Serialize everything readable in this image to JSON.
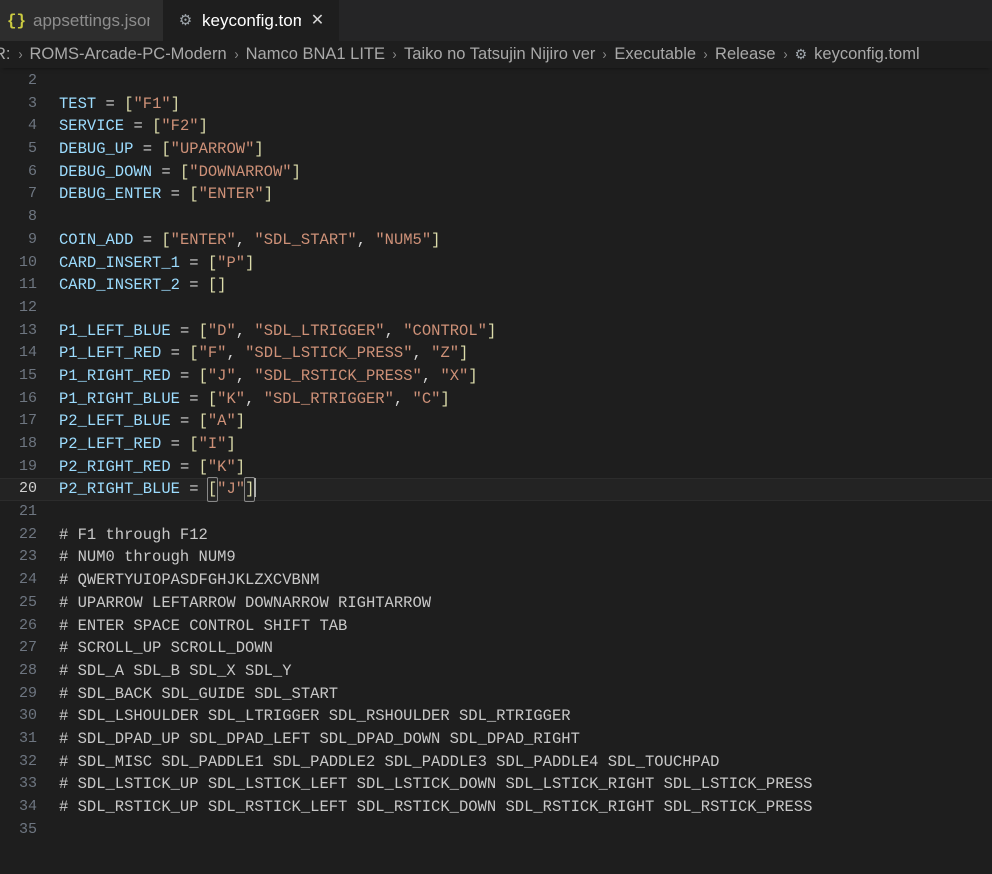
{
  "window": {
    "background": "#1e1e1e",
    "theme_name": "dark"
  },
  "tabbar": {
    "tabs": [
      {
        "label": "appsettings.json",
        "icon": "json-braces-icon",
        "icon_glyph": "{}",
        "icon_color": "#cbcb41",
        "active": false,
        "closable": false
      },
      {
        "label": "keyconfig.toml",
        "icon": "gear-icon",
        "icon_glyph": "⚙",
        "icon_color": "#a0a7ad",
        "active": true,
        "closable": true,
        "close_glyph": "✕"
      }
    ]
  },
  "breadcrumbs": {
    "separator": "›",
    "items": [
      {
        "label": "R:",
        "icon": null
      },
      {
        "label": "ROMS-Arcade-PC-Modern",
        "icon": null
      },
      {
        "label": "Namco BNA1 LITE",
        "icon": null
      },
      {
        "label": "Taiko no Tatsujin Nijiro ver",
        "icon": null
      },
      {
        "label": "Executable",
        "icon": null
      },
      {
        "label": "Release",
        "icon": null
      },
      {
        "label": "keyconfig.toml",
        "icon": "gear-icon",
        "icon_glyph": "⚙"
      }
    ]
  },
  "editor": {
    "language": "toml",
    "file_name": "keyconfig.toml",
    "cursor_line": 20,
    "first_visible_line": 2,
    "last_visible_line": 35,
    "colors": {
      "key": "#9cdcfe",
      "string": "#ce9178",
      "bracket": "#dcdcaa",
      "operator": "#d4d4d4",
      "comment": "#c8c8c8",
      "line_number": "#6e7681",
      "line_number_active": "#d0d0d0",
      "current_line_bg": "#232323",
      "cursor": "#aeafad"
    },
    "lines": [
      {
        "n": 2,
        "tokens": []
      },
      {
        "n": 3,
        "tokens": [
          {
            "t": "key",
            "v": "TEST"
          },
          {
            "t": "plain",
            "v": " "
          },
          {
            "t": "eq",
            "v": "="
          },
          {
            "t": "plain",
            "v": " "
          },
          {
            "t": "brk",
            "v": "["
          },
          {
            "t": "str",
            "v": "\"F1\""
          },
          {
            "t": "brk",
            "v": "]"
          }
        ]
      },
      {
        "n": 4,
        "tokens": [
          {
            "t": "key",
            "v": "SERVICE"
          },
          {
            "t": "plain",
            "v": " "
          },
          {
            "t": "eq",
            "v": "="
          },
          {
            "t": "plain",
            "v": " "
          },
          {
            "t": "brk",
            "v": "["
          },
          {
            "t": "str",
            "v": "\"F2\""
          },
          {
            "t": "brk",
            "v": "]"
          }
        ]
      },
      {
        "n": 5,
        "tokens": [
          {
            "t": "key",
            "v": "DEBUG_UP"
          },
          {
            "t": "plain",
            "v": " "
          },
          {
            "t": "eq",
            "v": "="
          },
          {
            "t": "plain",
            "v": " "
          },
          {
            "t": "brk",
            "v": "["
          },
          {
            "t": "str",
            "v": "\"UPARROW\""
          },
          {
            "t": "brk",
            "v": "]"
          }
        ]
      },
      {
        "n": 6,
        "tokens": [
          {
            "t": "key",
            "v": "DEBUG_DOWN"
          },
          {
            "t": "plain",
            "v": " "
          },
          {
            "t": "eq",
            "v": "="
          },
          {
            "t": "plain",
            "v": " "
          },
          {
            "t": "brk",
            "v": "["
          },
          {
            "t": "str",
            "v": "\"DOWNARROW\""
          },
          {
            "t": "brk",
            "v": "]"
          }
        ]
      },
      {
        "n": 7,
        "tokens": [
          {
            "t": "key",
            "v": "DEBUG_ENTER"
          },
          {
            "t": "plain",
            "v": " "
          },
          {
            "t": "eq",
            "v": "="
          },
          {
            "t": "plain",
            "v": " "
          },
          {
            "t": "brk",
            "v": "["
          },
          {
            "t": "str",
            "v": "\"ENTER\""
          },
          {
            "t": "brk",
            "v": "]"
          }
        ]
      },
      {
        "n": 8,
        "tokens": []
      },
      {
        "n": 9,
        "tokens": [
          {
            "t": "key",
            "v": "COIN_ADD"
          },
          {
            "t": "plain",
            "v": " "
          },
          {
            "t": "eq",
            "v": "="
          },
          {
            "t": "plain",
            "v": " "
          },
          {
            "t": "brk",
            "v": "["
          },
          {
            "t": "str",
            "v": "\"ENTER\""
          },
          {
            "t": "punct",
            "v": ", "
          },
          {
            "t": "str",
            "v": "\"SDL_START\""
          },
          {
            "t": "punct",
            "v": ", "
          },
          {
            "t": "str",
            "v": "\"NUM5\""
          },
          {
            "t": "brk",
            "v": "]"
          }
        ]
      },
      {
        "n": 10,
        "tokens": [
          {
            "t": "key",
            "v": "CARD_INSERT_1"
          },
          {
            "t": "plain",
            "v": " "
          },
          {
            "t": "eq",
            "v": "="
          },
          {
            "t": "plain",
            "v": " "
          },
          {
            "t": "brk",
            "v": "["
          },
          {
            "t": "str",
            "v": "\"P\""
          },
          {
            "t": "brk",
            "v": "]"
          }
        ]
      },
      {
        "n": 11,
        "tokens": [
          {
            "t": "key",
            "v": "CARD_INSERT_2"
          },
          {
            "t": "plain",
            "v": " "
          },
          {
            "t": "eq",
            "v": "="
          },
          {
            "t": "plain",
            "v": " "
          },
          {
            "t": "brk",
            "v": "[]"
          }
        ]
      },
      {
        "n": 12,
        "tokens": []
      },
      {
        "n": 13,
        "tokens": [
          {
            "t": "key",
            "v": "P1_LEFT_BLUE"
          },
          {
            "t": "plain",
            "v": " "
          },
          {
            "t": "eq",
            "v": "="
          },
          {
            "t": "plain",
            "v": " "
          },
          {
            "t": "brk",
            "v": "["
          },
          {
            "t": "str",
            "v": "\"D\""
          },
          {
            "t": "punct",
            "v": ", "
          },
          {
            "t": "str",
            "v": "\"SDL_LTRIGGER\""
          },
          {
            "t": "punct",
            "v": ", "
          },
          {
            "t": "str",
            "v": "\"CONTROL\""
          },
          {
            "t": "brk",
            "v": "]"
          }
        ]
      },
      {
        "n": 14,
        "tokens": [
          {
            "t": "key",
            "v": "P1_LEFT_RED"
          },
          {
            "t": "plain",
            "v": " "
          },
          {
            "t": "eq",
            "v": "="
          },
          {
            "t": "plain",
            "v": " "
          },
          {
            "t": "brk",
            "v": "["
          },
          {
            "t": "str",
            "v": "\"F\""
          },
          {
            "t": "punct",
            "v": ", "
          },
          {
            "t": "str",
            "v": "\"SDL_LSTICK_PRESS\""
          },
          {
            "t": "punct",
            "v": ", "
          },
          {
            "t": "str",
            "v": "\"Z\""
          },
          {
            "t": "brk",
            "v": "]"
          }
        ]
      },
      {
        "n": 15,
        "tokens": [
          {
            "t": "key",
            "v": "P1_RIGHT_RED"
          },
          {
            "t": "plain",
            "v": " "
          },
          {
            "t": "eq",
            "v": "="
          },
          {
            "t": "plain",
            "v": " "
          },
          {
            "t": "brk",
            "v": "["
          },
          {
            "t": "str",
            "v": "\"J\""
          },
          {
            "t": "punct",
            "v": ", "
          },
          {
            "t": "str",
            "v": "\"SDL_RSTICK_PRESS\""
          },
          {
            "t": "punct",
            "v": ", "
          },
          {
            "t": "str",
            "v": "\"X\""
          },
          {
            "t": "brk",
            "v": "]"
          }
        ]
      },
      {
        "n": 16,
        "tokens": [
          {
            "t": "key",
            "v": "P1_RIGHT_BLUE"
          },
          {
            "t": "plain",
            "v": " "
          },
          {
            "t": "eq",
            "v": "="
          },
          {
            "t": "plain",
            "v": " "
          },
          {
            "t": "brk",
            "v": "["
          },
          {
            "t": "str",
            "v": "\"K\""
          },
          {
            "t": "punct",
            "v": ", "
          },
          {
            "t": "str",
            "v": "\"SDL_RTRIGGER\""
          },
          {
            "t": "punct",
            "v": ", "
          },
          {
            "t": "str",
            "v": "\"C\""
          },
          {
            "t": "brk",
            "v": "]"
          }
        ]
      },
      {
        "n": 17,
        "tokens": [
          {
            "t": "key",
            "v": "P2_LEFT_BLUE"
          },
          {
            "t": "plain",
            "v": " "
          },
          {
            "t": "eq",
            "v": "="
          },
          {
            "t": "plain",
            "v": " "
          },
          {
            "t": "brk",
            "v": "["
          },
          {
            "t": "str",
            "v": "\"A\""
          },
          {
            "t": "brk",
            "v": "]"
          }
        ]
      },
      {
        "n": 18,
        "tokens": [
          {
            "t": "key",
            "v": "P2_LEFT_RED"
          },
          {
            "t": "plain",
            "v": " "
          },
          {
            "t": "eq",
            "v": "="
          },
          {
            "t": "plain",
            "v": " "
          },
          {
            "t": "brk",
            "v": "["
          },
          {
            "t": "str",
            "v": "\"I\""
          },
          {
            "t": "brk",
            "v": "]"
          }
        ]
      },
      {
        "n": 19,
        "tokens": [
          {
            "t": "key",
            "v": "P2_RIGHT_RED"
          },
          {
            "t": "plain",
            "v": " "
          },
          {
            "t": "eq",
            "v": "="
          },
          {
            "t": "plain",
            "v": " "
          },
          {
            "t": "brk",
            "v": "["
          },
          {
            "t": "str",
            "v": "\"K\""
          },
          {
            "t": "brk",
            "v": "]"
          }
        ]
      },
      {
        "n": 20,
        "current": true,
        "tokens": [
          {
            "t": "key",
            "v": "P2_RIGHT_BLUE"
          },
          {
            "t": "plain",
            "v": " "
          },
          {
            "t": "eq",
            "v": "="
          },
          {
            "t": "plain",
            "v": " "
          },
          {
            "t": "brk",
            "v": "[",
            "match": true
          },
          {
            "t": "str",
            "v": "\"J\""
          },
          {
            "t": "brk",
            "v": "]",
            "match": true
          },
          {
            "t": "cursor",
            "v": ""
          }
        ]
      },
      {
        "n": 21,
        "tokens": []
      },
      {
        "n": 22,
        "tokens": [
          {
            "t": "comment",
            "v": "# F1 through F12"
          }
        ]
      },
      {
        "n": 23,
        "tokens": [
          {
            "t": "comment",
            "v": "# NUM0 through NUM9"
          }
        ]
      },
      {
        "n": 24,
        "tokens": [
          {
            "t": "comment",
            "v": "# QWERTYUIOPASDFGHJKLZXCVBNM"
          }
        ]
      },
      {
        "n": 25,
        "tokens": [
          {
            "t": "comment",
            "v": "# UPARROW LEFTARROW DOWNARROW RIGHTARROW"
          }
        ]
      },
      {
        "n": 26,
        "tokens": [
          {
            "t": "comment",
            "v": "# ENTER SPACE CONTROL SHIFT TAB"
          }
        ]
      },
      {
        "n": 27,
        "tokens": [
          {
            "t": "comment",
            "v": "# SCROLL_UP SCROLL_DOWN"
          }
        ]
      },
      {
        "n": 28,
        "tokens": [
          {
            "t": "comment",
            "v": "# SDL_A SDL_B SDL_X SDL_Y"
          }
        ]
      },
      {
        "n": 29,
        "tokens": [
          {
            "t": "comment",
            "v": "# SDL_BACK SDL_GUIDE SDL_START"
          }
        ]
      },
      {
        "n": 30,
        "tokens": [
          {
            "t": "comment",
            "v": "# SDL_LSHOULDER SDL_LTRIGGER SDL_RSHOULDER SDL_RTRIGGER"
          }
        ]
      },
      {
        "n": 31,
        "tokens": [
          {
            "t": "comment",
            "v": "# SDL_DPAD_UP SDL_DPAD_LEFT SDL_DPAD_DOWN SDL_DPAD_RIGHT"
          }
        ]
      },
      {
        "n": 32,
        "tokens": [
          {
            "t": "comment",
            "v": "# SDL_MISC SDL_PADDLE1 SDL_PADDLE2 SDL_PADDLE3 SDL_PADDLE4 SDL_TOUCHPAD"
          }
        ]
      },
      {
        "n": 33,
        "tokens": [
          {
            "t": "comment",
            "v": "# SDL_LSTICK_UP SDL_LSTICK_LEFT SDL_LSTICK_DOWN SDL_LSTICK_RIGHT SDL_LSTICK_PRESS"
          }
        ]
      },
      {
        "n": 34,
        "tokens": [
          {
            "t": "comment",
            "v": "# SDL_RSTICK_UP SDL_RSTICK_LEFT SDL_RSTICK_DOWN SDL_RSTICK_RIGHT SDL_RSTICK_PRESS"
          }
        ]
      },
      {
        "n": 35,
        "tokens": []
      }
    ]
  }
}
